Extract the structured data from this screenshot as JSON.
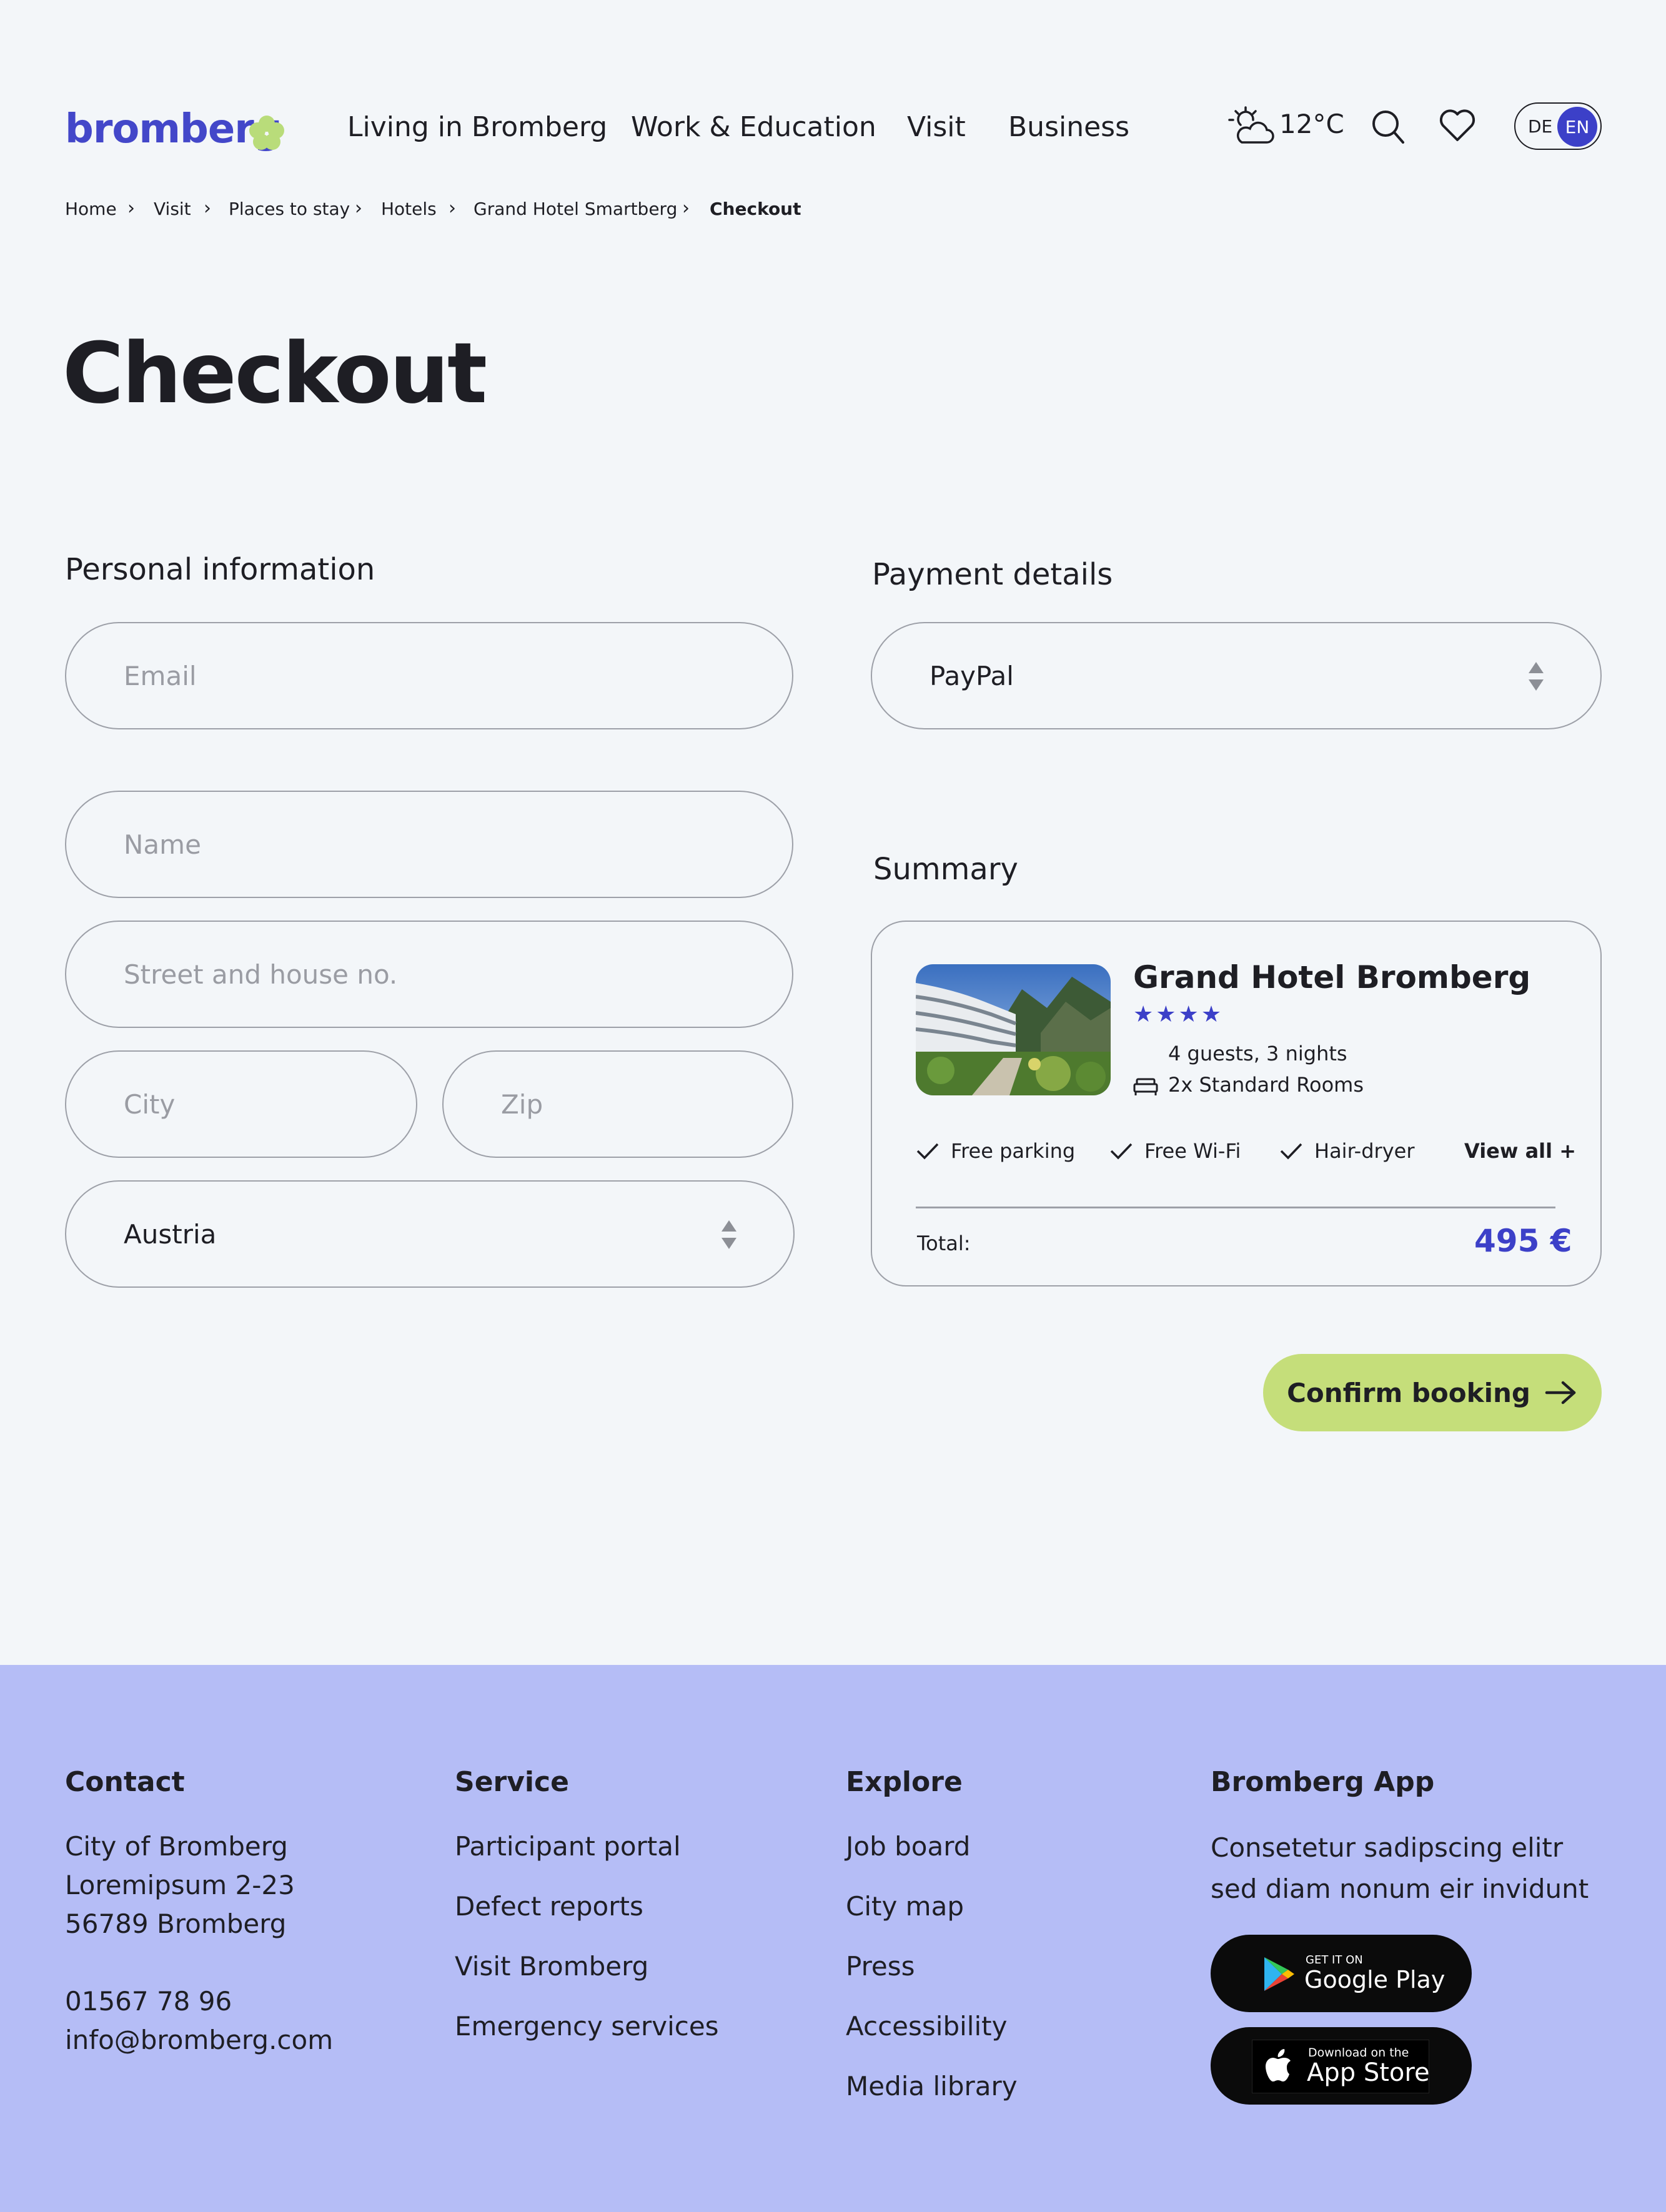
{
  "header": {
    "logo": "bromberg",
    "nav": [
      "Living in Bromberg",
      "Work & Education",
      "Visit",
      "Business"
    ],
    "temperature": "12°C",
    "lang_de": "DE",
    "lang_en": "EN"
  },
  "breadcrumb": [
    "Home",
    "Visit",
    "Places to stay",
    "Hotels",
    "Grand Hotel Smartberg",
    "Checkout"
  ],
  "page_title": "Checkout",
  "personal": {
    "heading": "Personal information",
    "email_placeholder": "Email",
    "name_placeholder": "Name",
    "street_placeholder": "Street and house no.",
    "city_placeholder": "City",
    "zip_placeholder": "Zip",
    "country_value": "Austria"
  },
  "payment": {
    "heading": "Payment details",
    "method": "PayPal"
  },
  "summary": {
    "heading": "Summary",
    "hotel_name": "Grand Hotel Bromberg",
    "stars": "★★★★",
    "star_count": 4,
    "guests": "4 guests, 3 nights",
    "rooms": "2x Standard Rooms",
    "amenities": [
      "Free parking",
      "Free Wi-Fi",
      "Hair-dryer"
    ],
    "view_all": "View all +",
    "total_label": "Total:",
    "total_price": "495 €"
  },
  "confirm_label": "Confirm booking",
  "footer": {
    "contact_heading": "Contact",
    "contact_lines": [
      "City of Bromberg",
      "Loremipsum 2-23",
      "56789 Bromberg"
    ],
    "phone": "01567 78 96",
    "email": "info@bromberg.com",
    "service_heading": "Service",
    "service_links": [
      "Participant portal",
      "Defect reports",
      "Visit Bromberg",
      "Emergency services"
    ],
    "explore_heading": "Explore",
    "explore_links": [
      "Job board",
      "City map",
      "Press",
      "Accessibility",
      "Media library"
    ],
    "app_heading": "Bromberg App",
    "app_text_1": "Consetetur sadipscing elitr",
    "app_text_2": "sed diam nonum eir invidunt",
    "google_small": "GET IT ON",
    "google_big": "Google Play",
    "apple_small": "Download on the",
    "apple_big": "App Store"
  },
  "colors": {
    "accent": "#3c40c8",
    "cta": "#c5de7a",
    "footer_bg": "#b5bdf6",
    "page_bg": "#f3f6f9"
  }
}
